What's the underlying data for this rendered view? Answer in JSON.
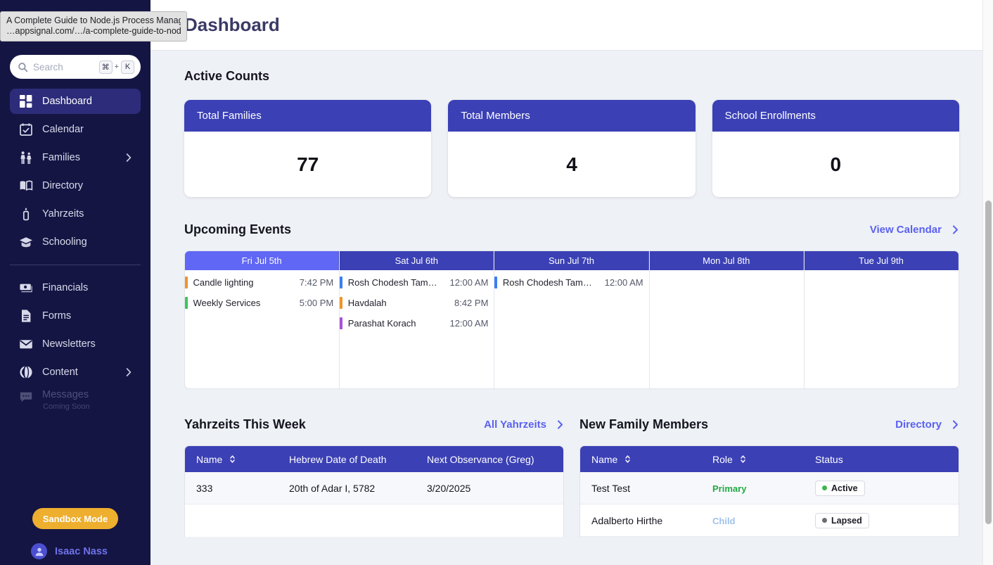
{
  "tooltip": {
    "title": "A Complete Guide to Node.js Process Manage…",
    "url": "…appsignal.com/…/a-complete-guide-to-node…"
  },
  "sidebar": {
    "search": {
      "placeholder": "Search",
      "value": "",
      "key_modifier": "⌘",
      "key_plus": "+",
      "key_letter": "K"
    },
    "nav_primary": [
      {
        "label": "Dashboard",
        "icon": "dashboard-icon",
        "active": true
      },
      {
        "label": "Calendar",
        "icon": "calendar-icon",
        "active": false
      },
      {
        "label": "Families",
        "icon": "families-icon",
        "active": false,
        "expandable": true
      },
      {
        "label": "Directory",
        "icon": "book-icon",
        "active": false
      },
      {
        "label": "Yahrzeits",
        "icon": "candle-icon",
        "active": false
      },
      {
        "label": "Schooling",
        "icon": "graduation-cap-icon",
        "active": false
      }
    ],
    "nav_secondary": [
      {
        "label": "Financials",
        "icon": "money-icon",
        "active": false
      },
      {
        "label": "Forms",
        "icon": "document-icon",
        "active": false
      },
      {
        "label": "Newsletters",
        "icon": "envelope-icon",
        "active": false
      },
      {
        "label": "Content",
        "icon": "globe-icon",
        "active": false,
        "expandable": true
      },
      {
        "label": "Messages",
        "sublabel": "Coming Soon",
        "icon": "chat-icon",
        "disabled": true
      }
    ],
    "sandbox_label": "Sandbox Mode",
    "user_name": "Isaac Nass"
  },
  "header": {
    "title": "Dashboard"
  },
  "active_counts": {
    "title": "Active Counts",
    "cards": [
      {
        "label": "Total Families",
        "value": "77"
      },
      {
        "label": "Total Members",
        "value": "4"
      },
      {
        "label": "School Enrollments",
        "value": "0"
      }
    ]
  },
  "upcoming_events": {
    "title": "Upcoming Events",
    "link_label": "View Calendar",
    "days": [
      {
        "label": "Fri Jul 5th",
        "today": true,
        "events": [
          {
            "name": "Candle lighting",
            "time": "7:42 PM",
            "color": "#f0932b"
          },
          {
            "name": "Weekly Services",
            "time": "5:00 PM",
            "color": "#3ec45c"
          }
        ]
      },
      {
        "label": "Sat Jul 6th",
        "today": false,
        "events": [
          {
            "name": "Rosh Chodesh Tam…",
            "time": "12:00 AM",
            "color": "#3b7ef0"
          },
          {
            "name": "Havdalah",
            "time": "8:42 PM",
            "color": "#f0932b"
          },
          {
            "name": "Parashat Korach",
            "time": "12:00 AM",
            "color": "#a950d8"
          }
        ]
      },
      {
        "label": "Sun Jul 7th",
        "today": false,
        "events": [
          {
            "name": "Rosh Chodesh Tam…",
            "time": "12:00 AM",
            "color": "#3b7ef0"
          }
        ]
      },
      {
        "label": "Mon Jul 8th",
        "today": false,
        "events": []
      },
      {
        "label": "Tue Jul 9th",
        "today": false,
        "events": []
      }
    ]
  },
  "yahrzeits": {
    "title": "Yahrzeits This Week",
    "link_label": "All Yahrzeits",
    "columns": [
      "Name",
      "Hebrew Date of Death",
      "Next Observance (Greg)"
    ],
    "rows": [
      {
        "name": "333",
        "hebrew_date": "20th of Adar I, 5782",
        "next_observance": "3/20/2025"
      }
    ]
  },
  "new_family_members": {
    "title": "New Family Members",
    "link_label": "Directory",
    "columns": [
      "Name",
      "Role",
      "Status"
    ],
    "rows": [
      {
        "name": "Test Test",
        "role": "Primary",
        "role_class": "role-primary",
        "status": "Active",
        "status_color": "#3cb54a"
      },
      {
        "name": "Adalberto Hirthe",
        "role": "Child",
        "role_class": "role-child",
        "status": "Lapsed",
        "status_color": "#6b6b72"
      }
    ]
  },
  "colors": {
    "sidebar_bg": "#151544",
    "accent_blue": "#3b40b5",
    "today_blue": "#6067f5",
    "link_blue": "#5a61f0",
    "sandbox_amber": "#eeae2e"
  }
}
